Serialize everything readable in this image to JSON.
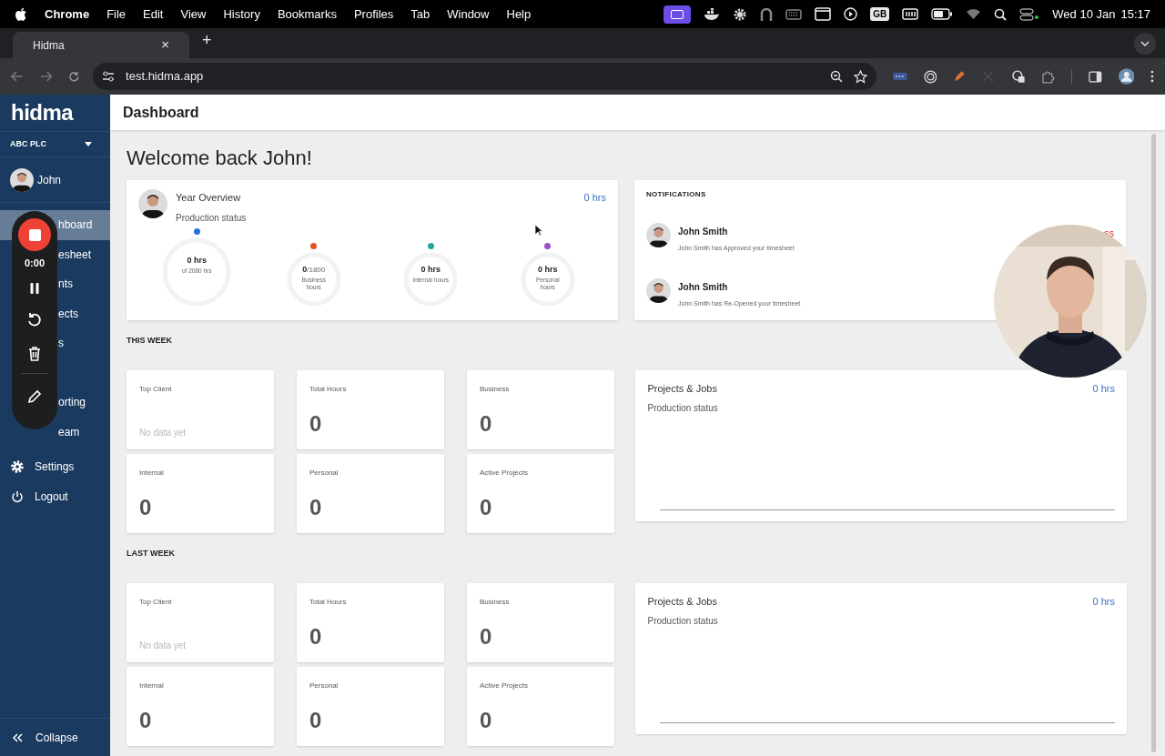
{
  "menu_bar": {
    "app": "Chrome",
    "menus": [
      "File",
      "Edit",
      "View",
      "History",
      "Bookmarks",
      "Profiles",
      "Tab",
      "Window",
      "Help"
    ],
    "input_source": "GB",
    "date": "Wed 10 Jan",
    "time": "15:17"
  },
  "browser": {
    "tab": {
      "title": "Hidma",
      "selected": true
    },
    "close": "×",
    "new_tab": "+",
    "url": "test.hidma.app"
  },
  "sidebar": {
    "logo": "hidma",
    "organization": "ABC PLC",
    "user": "John",
    "items": [
      {
        "label": "hboard",
        "selected": true
      },
      {
        "label": "esheet",
        "selected": false
      },
      {
        "label": "nts",
        "selected": false
      },
      {
        "label": "ects",
        "selected": false
      },
      {
        "label": "s",
        "selected": false
      },
      {
        "selected": false
      },
      {
        "label": "orting",
        "selected": false
      },
      {
        "label": "eam",
        "selected": false
      }
    ],
    "footer_items": [
      {
        "label": "Settings",
        "kind": "settings"
      },
      {
        "label": "Logout",
        "kind": "logout"
      }
    ],
    "collapse": "Collapse"
  },
  "header": {
    "title": "Dashboard"
  },
  "welcome": "Welcome back John!",
  "year_overview": {
    "title": "Year Overview",
    "subtitle": "Production status",
    "total": "0 hrs",
    "rings": [
      {
        "value": "0 hrs",
        "caption": "of 2080 hrs",
        "color": "#2d6fd8",
        "kind": "main"
      },
      {
        "value": "0",
        "suffix": "/1800",
        "caption": "Business hours",
        "color": "#e0521f",
        "kind": "small"
      },
      {
        "value": "0 hrs",
        "caption": "Internal hours",
        "color": "#26a69a",
        "kind": "small"
      },
      {
        "value": "0 hrs",
        "caption": "Personal hours",
        "color": "#9b4fc4",
        "kind": "small"
      }
    ]
  },
  "notifications": {
    "title": "NOTIFICATIONS",
    "items": [
      {
        "name": "John Smith",
        "message": "John Smith has Approved your timesheet",
        "status": "ss"
      },
      {
        "name": "John Smith",
        "message": "John Smith has Re-Opened your timesheet"
      }
    ]
  },
  "sections": [
    {
      "title": "THIS WEEK",
      "stats": [
        {
          "label": "Top Client",
          "value": "No data yet",
          "kind": "empty"
        },
        {
          "label": "Total Hours",
          "value": "0",
          "kind": "number"
        },
        {
          "label": "Business",
          "value": "0",
          "kind": "number"
        },
        {
          "label": "Internal",
          "value": "0",
          "kind": "number"
        },
        {
          "label": "Personal",
          "value": "0",
          "kind": "number"
        },
        {
          "label": "Active Projects",
          "value": "0",
          "kind": "number"
        }
      ],
      "projects": {
        "title": "Projects & Jobs",
        "subtitle": "Production status",
        "total": "0 hrs"
      }
    },
    {
      "title": "LAST WEEK",
      "stats": [
        {
          "label": "Top Client",
          "value": "No data yet",
          "kind": "empty"
        },
        {
          "label": "Total Hours",
          "value": "0",
          "kind": "number"
        },
        {
          "label": "Business",
          "value": "0",
          "kind": "number"
        },
        {
          "label": "Internal",
          "value": "0",
          "kind": "number"
        },
        {
          "label": "Personal",
          "value": "0",
          "kind": "number"
        },
        {
          "label": "Active Projects",
          "value": "0",
          "kind": "number"
        }
      ],
      "projects": {
        "title": "Projects & Jobs",
        "subtitle": "Production status",
        "total": "0 hrs"
      }
    }
  ],
  "recorder": {
    "timer": "0:00"
  }
}
